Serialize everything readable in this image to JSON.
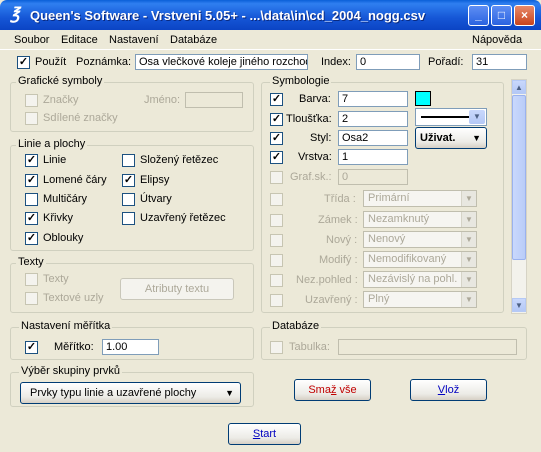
{
  "window": {
    "title": "Queen's Software - Vrstveni 5.05+ - ...\\data\\in\\cd_2004_nogg.csv",
    "minimize": "_",
    "maximize": "□",
    "close": "×"
  },
  "menu": {
    "soubor": "Soubor",
    "editace": "Editace",
    "nastaveni": "Nastavení",
    "databaze": "Databáze",
    "napoveda": "Nápověda"
  },
  "top": {
    "pouzit": "Použít",
    "poznamka_label": "Poznámka:",
    "poznamka_value": "Osa vlečkové koleje jiného rozchodu",
    "index_label": "Index:",
    "index_value": "0",
    "poradi_label": "Pořadí:",
    "poradi_value": "31"
  },
  "graficke": {
    "legend": "Grafické symboly",
    "znacky": "Značky",
    "jmeno": "Jméno:",
    "sdilene": "Sdílené značky"
  },
  "linie": {
    "legend": "Linie a plochy",
    "items": [
      "Linie",
      "Lomené čáry",
      "Multičáry",
      "Křivky",
      "Oblouky",
      "Složený řetězec",
      "Elipsy",
      "Útvary",
      "Uzavřený řetězec"
    ]
  },
  "texty": {
    "legend": "Texty",
    "texty": "Texty",
    "uzly": "Textové uzly",
    "atributy": "Atributy textu"
  },
  "meritko": {
    "legend": "Nastavení měřítka",
    "label": "Měřítko:",
    "value": "1.00"
  },
  "vyber": {
    "legend": "Výběr skupiny prvků",
    "selected": "Prvky typu linie a uzavřené plochy"
  },
  "symbologie": {
    "legend": "Symbologie",
    "barva_label": "Barva:",
    "barva_value": "7",
    "barva_color": "#00FFFF",
    "tloustka_label": "Tloušťka:",
    "tloustka_value": "2",
    "styl_label": "Styl:",
    "styl_value": "Osa2",
    "styl_button": "Uživat.",
    "vrstva_label": "Vrstva:",
    "vrstva_value": "1",
    "grafsk_label": "Graf.sk.:",
    "grafsk_value": "0",
    "rows": [
      {
        "label": "Třída :",
        "value": "Primární"
      },
      {
        "label": "Zámek :",
        "value": "Nezamknutý"
      },
      {
        "label": "Nový :",
        "value": "Nenový"
      },
      {
        "label": "Modifý :",
        "value": "Nemodifikovaný"
      },
      {
        "label": "Nez.pohled :",
        "value": "Nezávislý na pohl."
      },
      {
        "label": "Uzavřený :",
        "value": "Plný"
      }
    ]
  },
  "databaze": {
    "legend": "Databáze",
    "tabulka": "Tabulka:"
  },
  "buttons": {
    "smaz_pre": "Sma",
    "smaz_u": "ž",
    "smaz_post": " vše",
    "vloz_pre": "",
    "vloz_u": "V",
    "vloz_post": "lož",
    "start_pre": "",
    "start_u": "S",
    "start_post": "tart"
  }
}
